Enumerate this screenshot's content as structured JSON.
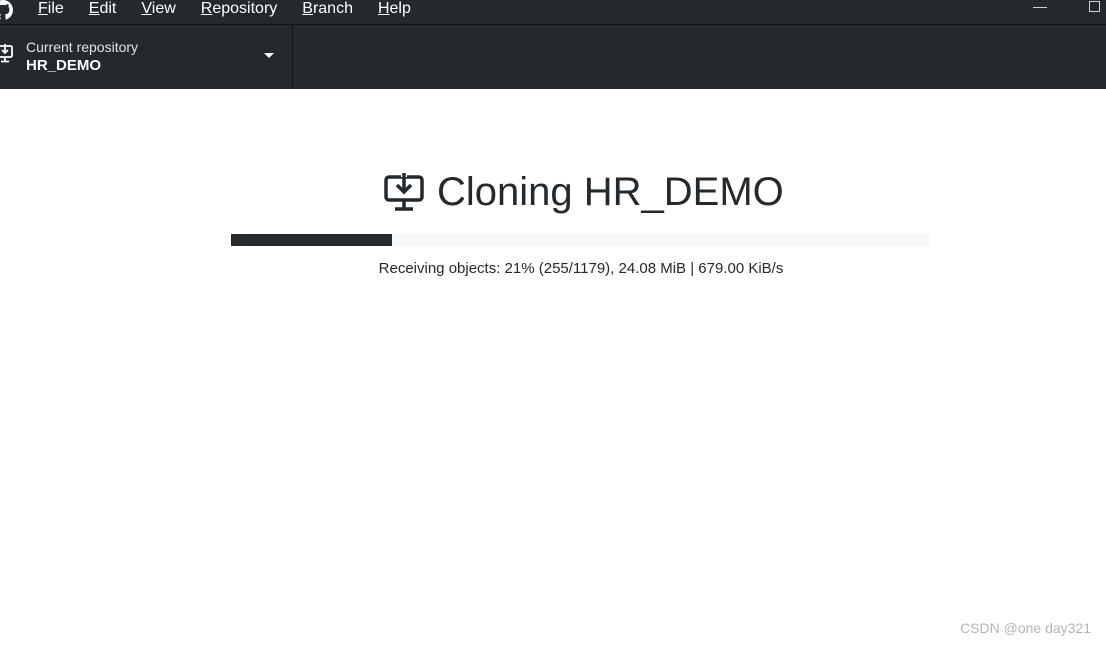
{
  "menu": {
    "items": [
      {
        "accel": "F",
        "rest": "ile"
      },
      {
        "accel": "E",
        "rest": "dit"
      },
      {
        "accel": "V",
        "rest": "iew"
      },
      {
        "accel": "R",
        "rest": "epository"
      },
      {
        "accel": "B",
        "rest": "ranch"
      },
      {
        "accel": "H",
        "rest": "elp"
      }
    ]
  },
  "toolbar": {
    "repo_caption": "Current repository",
    "repo_name": "HR_DEMO"
  },
  "clone": {
    "title": "Cloning HR_DEMO",
    "progress_fraction": 0.23,
    "status": "Receiving objects: 21% (255/1179), 24.08 MiB | 679.00 KiB/s"
  },
  "watermark": "CSDN @one day321",
  "icons": {
    "app": "github-icon",
    "repo": "computer-download-icon",
    "clone": "computer-download-icon",
    "caret": "caret-down-icon"
  },
  "colors": {
    "chrome_bg": "#24292e",
    "page_bg": "#ffffff",
    "progress_track": "#f6f8fa",
    "progress_fill": "#24292e",
    "text": "#24292e"
  }
}
